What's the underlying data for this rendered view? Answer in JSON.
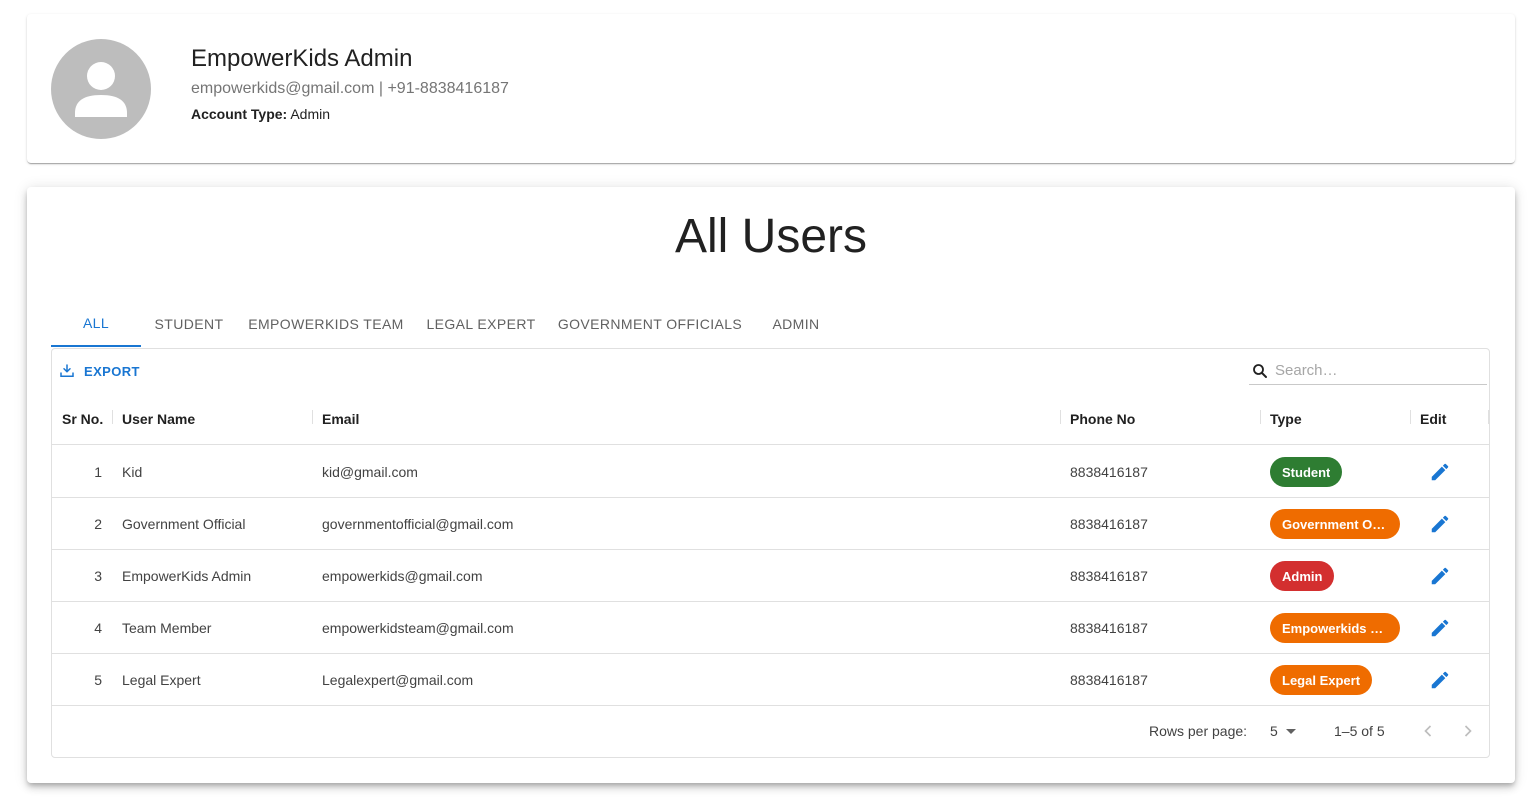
{
  "profile": {
    "name": "EmpowerKids Admin",
    "email": "empowerkids@gmail.com",
    "separator": " | ",
    "phone": "+91-8838416187",
    "account_type_label": "Account Type:",
    "account_type_value": "Admin",
    "avatar_icon": "person-icon"
  },
  "page_title": "All Users",
  "tabs": [
    {
      "label": "All",
      "active": true
    },
    {
      "label": "Student",
      "active": false
    },
    {
      "label": "EmpowerKids Team",
      "active": false
    },
    {
      "label": "Legal Expert",
      "active": false
    },
    {
      "label": "Government Officials",
      "active": false
    },
    {
      "label": "Admin",
      "active": false
    }
  ],
  "toolbar": {
    "export_label": "EXPORT",
    "export_icon": "download-icon",
    "search_placeholder": "Search…",
    "search_value": "",
    "search_icon": "search-icon"
  },
  "table": {
    "columns": [
      "Sr No.",
      "User Name",
      "Email",
      "Phone No",
      "Type",
      "Edit"
    ],
    "rows": [
      {
        "sr": "1",
        "name": "Kid",
        "email": "kid@gmail.com",
        "phone": "8838416187",
        "type": "Student",
        "type_display": "Student",
        "type_color": "#2e7d32"
      },
      {
        "sr": "2",
        "name": "Government Official",
        "email": "governmentofficial@gmail.com",
        "phone": "8838416187",
        "type": "Government Official",
        "type_display": "Government Offi…",
        "type_color": "#ef6c00"
      },
      {
        "sr": "3",
        "name": "EmpowerKids Admin",
        "email": "empowerkids@gmail.com",
        "phone": "8838416187",
        "type": "Admin",
        "type_display": "Admin",
        "type_color": "#d32f2f"
      },
      {
        "sr": "4",
        "name": "Team Member",
        "email": "empowerkidsteam@gmail.com",
        "phone": "8838416187",
        "type": "Empowerkids Team",
        "type_display": "Empowerkids T…",
        "type_color": "#ef6c00"
      },
      {
        "sr": "5",
        "name": "Legal Expert",
        "email": "Legalexpert@gmail.com",
        "phone": "8838416187",
        "type": "Legal Expert",
        "type_display": "Legal Expert",
        "type_color": "#ef6c00"
      }
    ],
    "edit_icon": "pencil-icon"
  },
  "pagination": {
    "rows_per_page_label": "Rows per page:",
    "rows_per_page_value": "5",
    "range_text": "1–5 of 5",
    "prev_icon": "chevron-left-icon",
    "next_icon": "chevron-right-icon"
  },
  "colors": {
    "accent": "#1976d2",
    "student": "#2e7d32",
    "admin": "#d32f2f",
    "other": "#ef6c00",
    "avatar_bg": "#bdbdbd"
  }
}
